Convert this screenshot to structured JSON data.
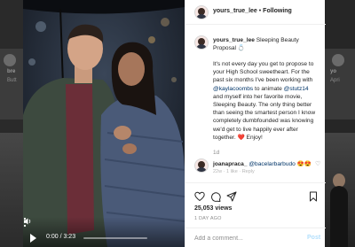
{
  "background_feed": {
    "left_username": "bre",
    "left_sub": "Butt",
    "right_username": "yo",
    "right_sub": "Apri"
  },
  "video": {
    "time": "0:00 / 3:23",
    "progress": 0.0,
    "icons": [
      "play-icon",
      "volume-icon",
      "more-options-icon"
    ]
  },
  "post_header": {
    "username": "yours_true_lee",
    "separator": "•",
    "follow_label": "Following"
  },
  "caption": {
    "username": "yours_true_lee",
    "title": "Sleeping Beauty Proposal",
    "title_emoji": "💍",
    "p1": "It's not every day you get to propose to your High School sweetheart. For the past six months I've been working with ",
    "mention1": "@kaylacoombs",
    "p2": " to animate ",
    "mention2": "@stutz14",
    "p3": " and myself into her favorite movie, Sleeping Beauty. The only thing better than seeing the smartest person I know completely dumbfounded was knowing we'd get to live happily ever after together. ",
    "heart": "❤️",
    "p4": " Enjoy!",
    "age": "1d"
  },
  "comment": {
    "username": "joanapraca_",
    "text": "@bacelarbarbudo",
    "emojis": "😍😍",
    "meta": "22w · 1 like · Reply"
  },
  "actions": {
    "icons": [
      "heart-icon",
      "comment-icon",
      "share-icon",
      "save-icon"
    ]
  },
  "stats": {
    "views": "25,053 views",
    "posted": "1 DAY AGO"
  },
  "comment_box": {
    "placeholder": "Add a comment...",
    "post_label": "Post"
  },
  "colors": {
    "link": "#003569",
    "post_disabled": "#b2dffc",
    "heart_red": "#ed4956"
  }
}
